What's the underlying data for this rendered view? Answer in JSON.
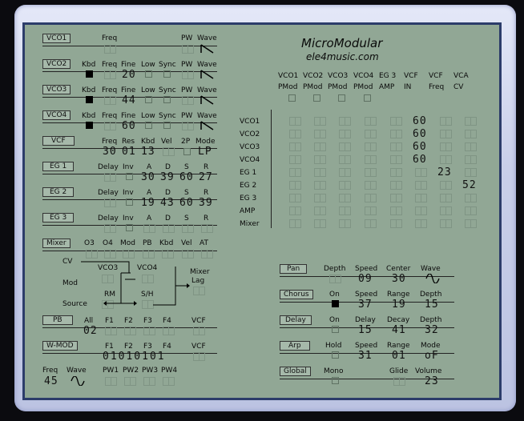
{
  "app": {
    "title": "MicroModular",
    "subtitle": "ele4music.com"
  },
  "vco1": {
    "label": "VCO1",
    "freq": "Freq",
    "pw": "PW",
    "wave": "Wave"
  },
  "vco2": {
    "label": "VCO2",
    "kbd": "Kbd",
    "freq": "Freq",
    "fine": "Fine",
    "low": "Low",
    "sync": "Sync",
    "pw": "PW",
    "wave": "Wave",
    "fine_value": "20"
  },
  "vco3": {
    "label": "VCO3",
    "kbd": "Kbd",
    "freq": "Freq",
    "fine": "Fine",
    "low": "Low",
    "sync": "Sync",
    "pw": "PW",
    "wave": "Wave",
    "fine_value": "44"
  },
  "vco4": {
    "label": "VCO4",
    "kbd": "Kbd",
    "freq": "Freq",
    "fine": "Fine",
    "low": "Low",
    "sync": "Sync",
    "pw": "PW",
    "wave": "Wave",
    "fine_value": "60"
  },
  "vcf": {
    "label": "VCF",
    "freq": "Freq",
    "res": "Res",
    "kbd": "Kbd",
    "vel": "Vel",
    "twop": "2P",
    "mode": "Mode",
    "freq_value": "30",
    "res_value": "01",
    "kbd_value": "13",
    "mode_value": "LP"
  },
  "eg1": {
    "label": "EG 1",
    "delay": "Delay",
    "inv": "Inv",
    "a": "A",
    "d": "D",
    "s": "S",
    "r": "R",
    "a_value": "30",
    "d_value": "39",
    "s_value": "60",
    "r_value": "27"
  },
  "eg2": {
    "label": "EG 2",
    "delay": "Delay",
    "inv": "Inv",
    "a": "A",
    "d": "D",
    "s": "S",
    "r": "R",
    "a_value": "19",
    "d_value": "43",
    "s_value": "60",
    "r_value": "39"
  },
  "eg3": {
    "label": "EG 3",
    "delay": "Delay",
    "inv": "Inv",
    "a": "A",
    "d": "D",
    "s": "S",
    "r": "R"
  },
  "mixer": {
    "label": "Mixer",
    "o3": "O3",
    "o4": "O4",
    "mod": "Mod",
    "pb": "PB",
    "kbd": "Kbd",
    "vel": "Vel",
    "at": "AT"
  },
  "modsection": {
    "cv": "CV",
    "mod": "Mod",
    "source": "Source",
    "vco3": "VCO3",
    "vco4": "VCO4",
    "rm": "RM",
    "sh": "S/H",
    "mixer": "Mixer",
    "lag": "Lag"
  },
  "pb": {
    "label": "PB",
    "all": "All",
    "f1": "F1",
    "f2": "F2",
    "f3": "F3",
    "f4": "F4",
    "vcf": "VCF",
    "all_value": "02"
  },
  "wmod": {
    "label": "W-MOD",
    "f1": "F1",
    "f2": "F2",
    "f3": "F3",
    "f4": "F4",
    "vcf": "VCF",
    "bits_value": "01010101"
  },
  "bottom": {
    "freq": "Freq",
    "wave": "Wave",
    "freq_value": "45",
    "pw1": "PW1",
    "pw2": "PW2",
    "pw3": "PW3",
    "pw4": "PW4"
  },
  "matrix": {
    "columns": [
      [
        "VCO1",
        "PMod"
      ],
      [
        "VCO2",
        "PMod"
      ],
      [
        "VCO3",
        "PMod"
      ],
      [
        "VCO4",
        "PMod"
      ],
      [
        "EG 3",
        "AMP"
      ],
      [
        "VCF",
        "IN"
      ],
      [
        "VCF",
        "Freq"
      ],
      [
        "VCA",
        "CV"
      ]
    ],
    "rows": [
      "VCO1",
      "VCO2",
      "VCO3",
      "VCO4",
      "EG 1",
      "EG 2",
      "EG 3",
      "AMP",
      "Mixer"
    ],
    "values": [
      [
        "",
        "",
        "",
        "",
        "",
        "60",
        "",
        ""
      ],
      [
        "",
        "",
        "",
        "",
        "",
        "60",
        "",
        ""
      ],
      [
        "",
        "",
        "",
        "",
        "",
        "60",
        "",
        ""
      ],
      [
        "",
        "",
        "",
        "",
        "",
        "60",
        "",
        ""
      ],
      [
        "",
        "",
        "",
        "",
        "",
        "",
        "23",
        ""
      ],
      [
        "",
        "",
        "",
        "",
        "",
        "",
        "",
        "52"
      ],
      [
        "",
        "",
        "",
        "",
        "",
        "",
        "",
        ""
      ],
      [
        "",
        "",
        "",
        "",
        "",
        "",
        "",
        ""
      ],
      [
        "",
        "",
        "",
        "",
        "",
        "",
        "",
        ""
      ]
    ]
  },
  "pan": {
    "label": "Pan",
    "depth": "Depth",
    "speed": "Speed",
    "center": "Center",
    "wave": "Wave",
    "speed_value": "09",
    "center_value": "30"
  },
  "chorus": {
    "label": "Chorus",
    "on": "On",
    "speed": "Speed",
    "range": "Range",
    "depth": "Depth",
    "speed_value": "37",
    "range_value": "19",
    "depth_value": "15"
  },
  "delay": {
    "label": "Delay",
    "on": "On",
    "delay": "Delay",
    "decay": "Decay",
    "depth": "Depth",
    "delay_value": "15",
    "decay_value": "41",
    "depth_value": "32"
  },
  "arp": {
    "label": "Arp",
    "hold": "Hold",
    "speed": "Speed",
    "range": "Range",
    "mode": "Mode",
    "speed_value": "31",
    "range_value": "01",
    "mode_value": "oF"
  },
  "global": {
    "label": "Global",
    "mono": "Mono",
    "glide": "Glide",
    "volume": "Volume",
    "volume_value": "23"
  },
  "colors": {
    "panel": "#91a795",
    "border": "#2c3c6a",
    "bezel": "#c9cfe9"
  }
}
